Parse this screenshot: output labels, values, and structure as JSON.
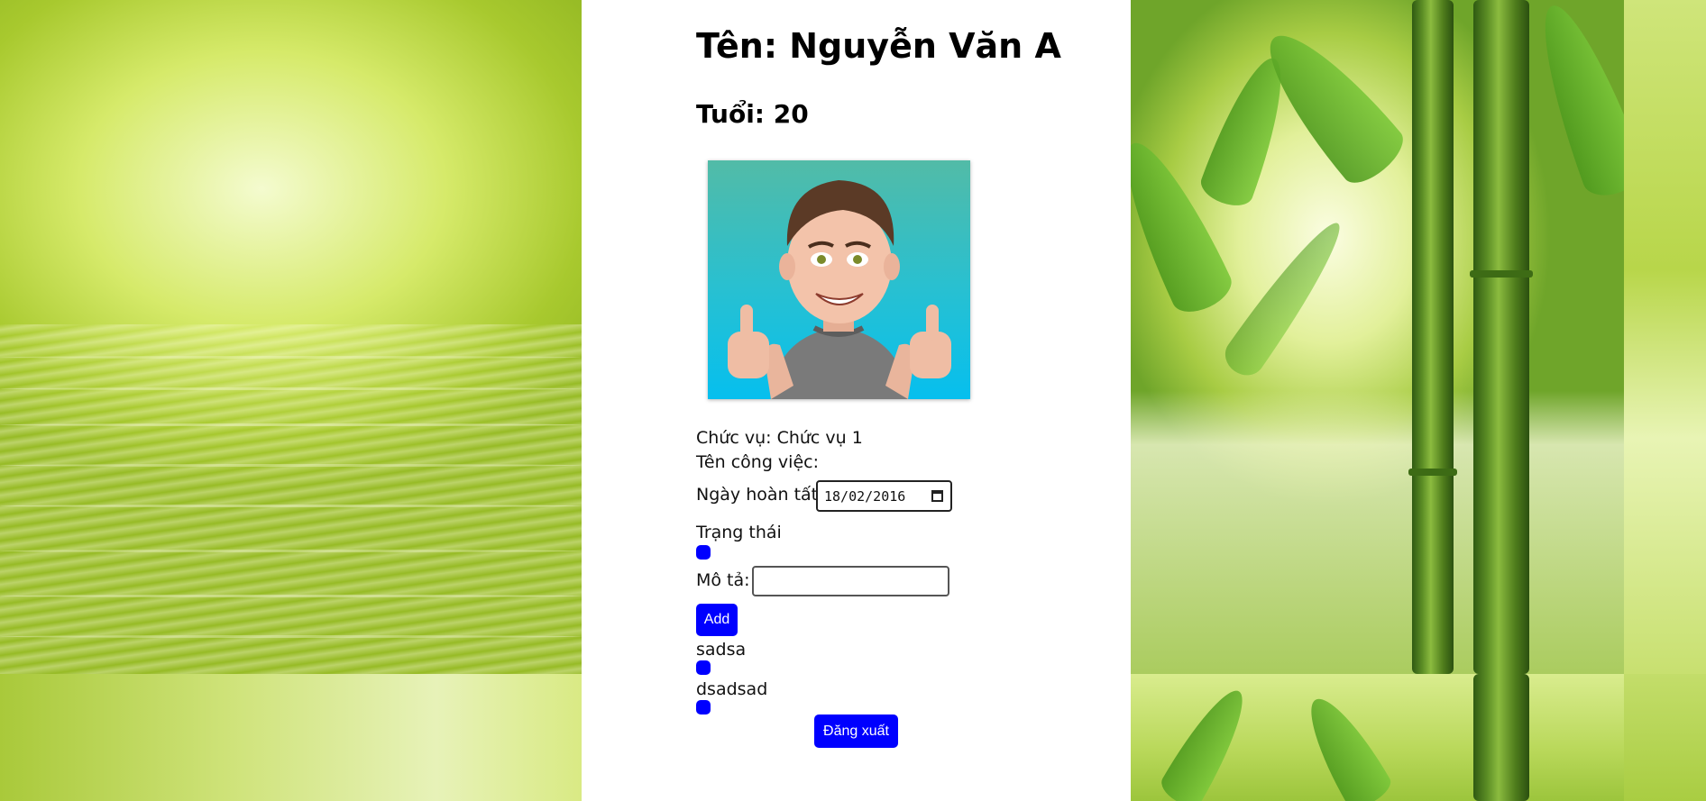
{
  "profile": {
    "name": "Tên: Nguyễn Văn A",
    "age": "Tuổi: 20",
    "role": "Chức vụ: Chức vụ 1",
    "job_name": "Tên công việc:"
  },
  "form": {
    "due_date_label": "Ngày hoàn tất",
    "due_date_value": "18/02/2016",
    "status_label": "Trạng thái",
    "description_label": "Mô tả:",
    "description_value": "",
    "add_label": "Add"
  },
  "tasks": [
    {
      "label": "sadsa"
    },
    {
      "label": "dsadsad"
    }
  ],
  "logout_label": "Đăng xuất",
  "colors": {
    "accent": "#0000ff",
    "panel": "#ffffff"
  },
  "icons": {
    "avatar": "smiling-avatar-thumbs-up",
    "date": "calendar-icon"
  }
}
